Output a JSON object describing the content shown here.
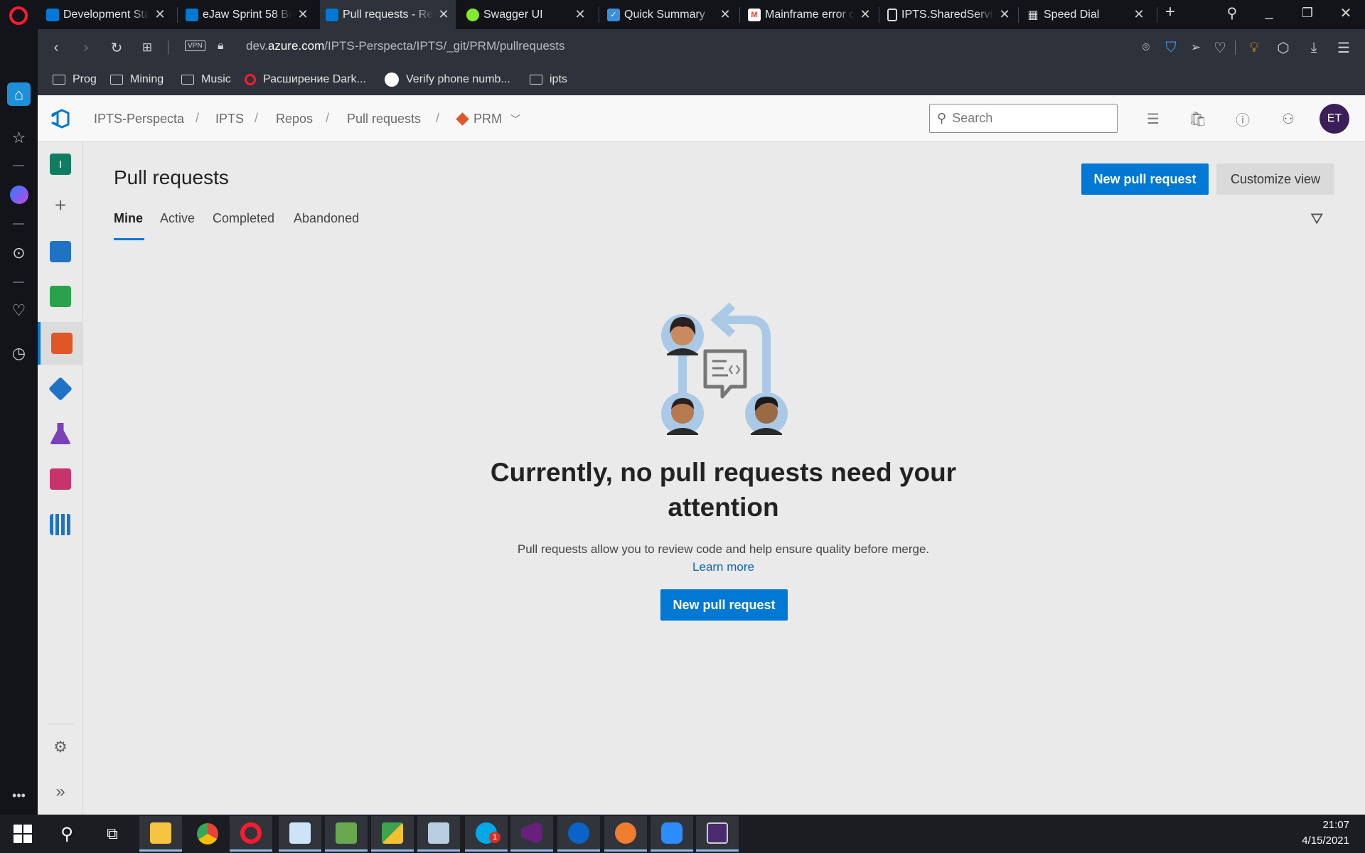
{
  "browser": {
    "tabs": [
      {
        "title": "Development Star",
        "icon_color": "#0078d4"
      },
      {
        "title": "eJaw Sprint 58 Ba",
        "icon_color": "#0078d4"
      },
      {
        "title": "Pull requests - Re",
        "icon_color": "#0078d4",
        "active": true
      },
      {
        "title": "Swagger UI",
        "icon_color": "#85ea2d"
      },
      {
        "title": "Quick Summary",
        "icon_color": "#3a8fd9"
      },
      {
        "title": "Mainframe error c",
        "icon_color": "#ea4335"
      },
      {
        "title": "IPTS.SharedServic",
        "icon_color": "#dddddd"
      },
      {
        "title": "Speed Dial",
        "icon_color": "#dddddd"
      }
    ],
    "address_prefix": "dev.",
    "address_host": "azure.com",
    "address_path": "/IPTS-Perspecta/IPTS/_git/PRM/pullrequests",
    "vpn_label": "VPN",
    "bookmarks": [
      {
        "label": "Prog",
        "icon": "folder-icon"
      },
      {
        "label": "Mining",
        "icon": "folder-icon"
      },
      {
        "label": "Music",
        "icon": "folder-icon"
      },
      {
        "label": "Расширение Dark...",
        "icon": "opera-icon"
      },
      {
        "label": "Verify phone numb...",
        "icon": "play-icon"
      },
      {
        "label": "ipts",
        "icon": "folder-icon"
      }
    ]
  },
  "ado": {
    "breadcrumb": [
      "IPTS-Perspecta",
      "IPTS",
      "Repos",
      "Pull requests"
    ],
    "repo_name": "PRM",
    "search_placeholder": "Search",
    "avatar_initials": "ET",
    "nav_items": [
      {
        "name": "project-overview",
        "letter": "I",
        "color": "#0e7d62"
      },
      {
        "name": "add",
        "color": "#666666"
      },
      {
        "name": "boards",
        "color": "#1f72c4"
      },
      {
        "name": "test-plans-board",
        "color": "#2aa24b"
      },
      {
        "name": "repos",
        "color": "#e05624"
      },
      {
        "name": "pipelines",
        "color": "#1f72c4"
      },
      {
        "name": "test-plans",
        "color": "#7b3fb8"
      },
      {
        "name": "artifacts",
        "color": "#c7336b"
      },
      {
        "name": "analytics",
        "color": "#1f72c4"
      }
    ]
  },
  "page": {
    "title": "Pull requests",
    "new_pr_label": "New pull request",
    "customize_label": "Customize view",
    "pivots": [
      "Mine",
      "Active",
      "Completed",
      "Abandoned"
    ],
    "selected_pivot": "Mine",
    "empty_title": "Currently, no pull requests need your attention",
    "empty_desc": "Pull requests allow you to review code and help ensure quality before merge.",
    "learn_more": "Learn more",
    "empty_button": "New pull request"
  },
  "taskbar": {
    "time": "21:07",
    "date": "4/15/2021",
    "badge_count": "1"
  }
}
